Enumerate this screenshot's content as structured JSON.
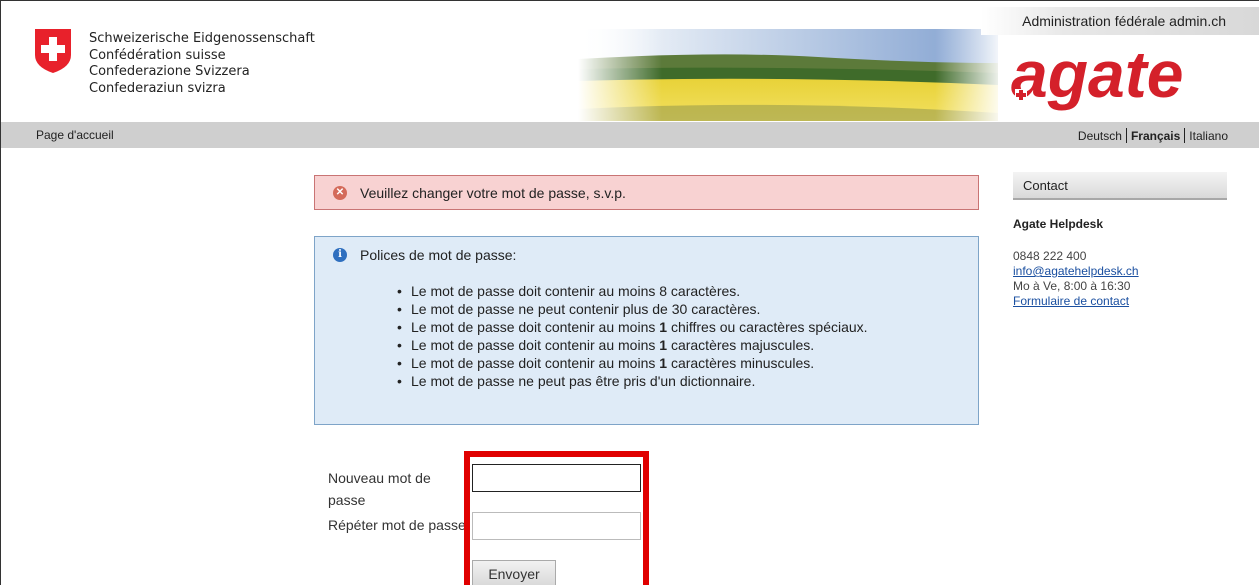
{
  "header": {
    "confederation_lines": [
      "Schweizerische Eidgenossenschaft",
      "Confédération suisse",
      "Confederazione Svizzera",
      "Confederaziun svizra"
    ],
    "admin_label": "Administration fédérale admin.ch",
    "logo_text": "agate"
  },
  "nav": {
    "home": "Page d'accueil",
    "languages": [
      "Deutsch",
      "Français",
      "Italiano"
    ],
    "current_language": "Français"
  },
  "alert": {
    "error_text": "Veuillez changer votre mot de passe, s.v.p."
  },
  "policy": {
    "title": "Polices de mot de passe:",
    "rules": [
      "Le mot de passe doit contenir au moins 8 caractères.",
      "Le mot de passe ne peut contenir plus de 30 caractères.",
      "Le mot de passe doit contenir au moins 1 chiffres ou caractères spéciaux.",
      "Le mot de passe doit contenir au moins 1 caractères majuscules.",
      "Le mot de passe doit contenir au moins 1 caractères minuscules.",
      "Le mot de passe ne peut pas être pris d'un dictionnaire."
    ]
  },
  "form": {
    "new_password_label": "Nouveau mot de passe",
    "repeat_password_label": "Répéter mot de passe",
    "new_password_value": "",
    "repeat_password_value": "",
    "submit_label": "Envoyer"
  },
  "sidebar": {
    "heading": "Contact",
    "title": "Agate Helpdesk",
    "phone": "0848 222 400",
    "email": "info@agatehelpdesk.ch",
    "hours": "Mo à Ve, 8:00 à 16:30",
    "form_link": "Formulaire de contact"
  },
  "colors": {
    "flag_red": "#e8212b",
    "error_bg": "#f8d2d2",
    "info_bg": "#dfebf7",
    "highlight": "#e00000",
    "link": "#1a4fa0"
  }
}
